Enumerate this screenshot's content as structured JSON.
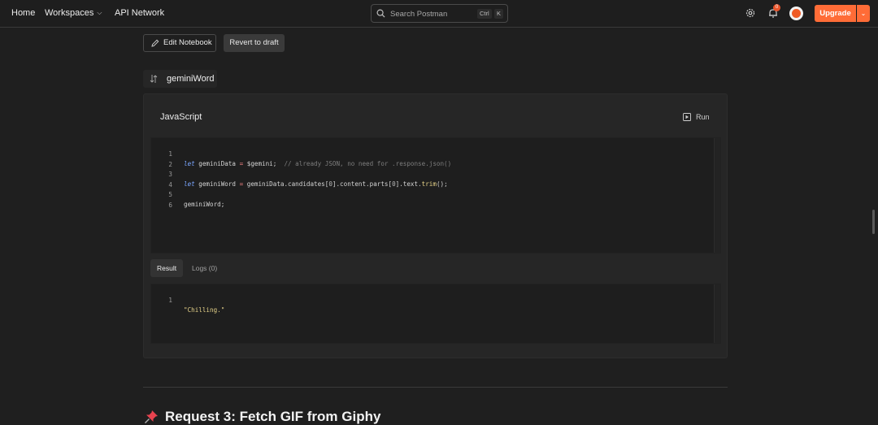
{
  "nav": {
    "home": "Home",
    "workspaces": "Workspaces",
    "api_network": "API Network"
  },
  "search": {
    "placeholder": "Search Postman",
    "shortcut_ctrl": "Ctrl",
    "shortcut_k": "K"
  },
  "topbar": {
    "notification_count": "0",
    "upgrade_label": "Upgrade",
    "accent_color": "#ff6c37"
  },
  "toolbar": {
    "edit_label": "Edit Notebook",
    "revert_label": "Revert to draft"
  },
  "block": {
    "name": "geminiWord",
    "language": "JavaScript",
    "run_label": "Run"
  },
  "code": {
    "line_numbers": [
      "1",
      "2",
      "3",
      "4",
      "5",
      "6"
    ],
    "line1": {
      "kw": "let",
      "var": " geminiData ",
      "op": "=",
      "rest": " $gemini;  ",
      "comment": "// already JSON, no need for .response.json()"
    },
    "line3": {
      "kw": "let",
      "var": " geminiWord ",
      "op": "=",
      "a": " geminiData.candidates[",
      "n1": "0",
      "b": "].content.parts[",
      "n2": "0",
      "c": "].text.",
      "fn": "trim",
      "d": "();"
    },
    "line5": "geminiWord;"
  },
  "result_tabs": {
    "result": "Result",
    "logs": "Logs (0)"
  },
  "result": {
    "line_number": "1",
    "value": "\"Chilling.\""
  },
  "next_section": {
    "heading": "Request 3: Fetch GIF from Giphy"
  }
}
